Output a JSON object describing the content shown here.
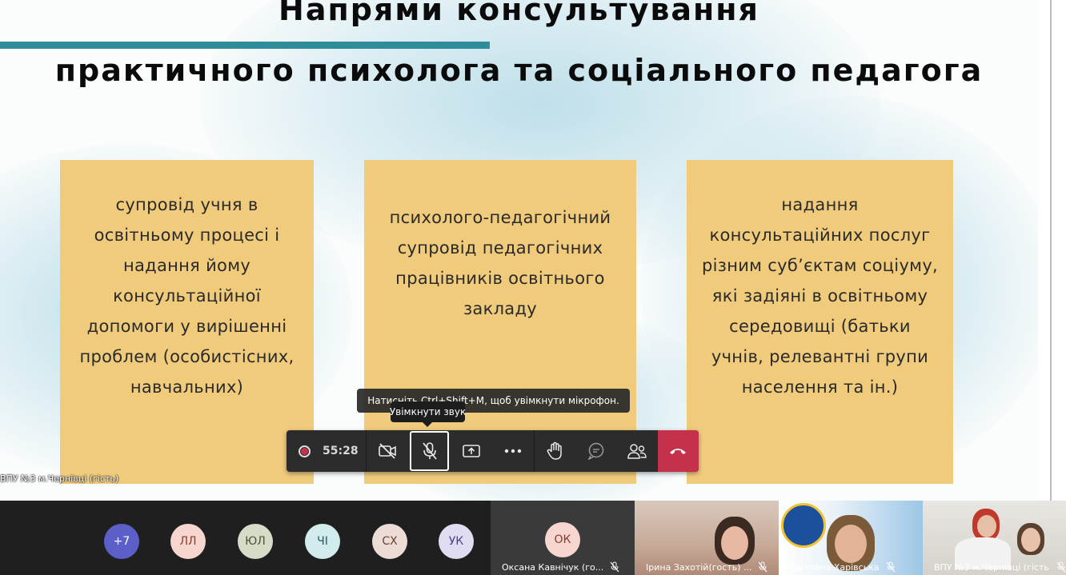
{
  "slide": {
    "title_line1": "Напрями консультування",
    "title_line2": "практичного психолога та соціального педагога",
    "cards": [
      "супровід учня в\nосвітньому процесі і\nнадання йому\nконсультаційної\nдопомоги у вирішенні\nпроблем (особистісних,\nнавчальних)",
      "психолого-педагогічний\nсупровід педагогічних\nпрацівників освітнього\nзакладу",
      "надання\nконсультаційних послуг\nрізним суб’єктам соціуму,\nякі задіяні в освітньому\nсередовищі (батьки\nучнів, релевантні групи\nнаселення та ін.)"
    ],
    "presenter_label": "ВПУ №3 м.Чернівці (гість)",
    "colors": {
      "card": "#f1cb7c",
      "accent_bar": "#2e8d98"
    }
  },
  "tooltips": {
    "hotkey": "Натисніть Ctrl+Shift+M, щоб увімкнути мікрофон.",
    "unmute": "Увімкнути звук"
  },
  "controls": {
    "timer": "55:28",
    "buttons": [
      {
        "name": "camera-off-button",
        "icon": "camera-off-icon"
      },
      {
        "name": "mic-unmute-button",
        "icon": "mic-off-icon"
      },
      {
        "name": "share-screen-button",
        "icon": "share-screen-icon"
      },
      {
        "name": "more-options-button",
        "icon": "more-icon"
      },
      {
        "name": "raise-hand-button",
        "icon": "hand-icon"
      },
      {
        "name": "chat-button",
        "icon": "chat-icon"
      },
      {
        "name": "participants-button",
        "icon": "people-icon"
      },
      {
        "name": "hang-up-button",
        "icon": "phone-hangup-icon"
      }
    ],
    "hangup_color": "#c4314b"
  },
  "participants": {
    "overflow": "+7",
    "avatars": [
      "ЛЛ",
      "ЮЛ",
      "ЧІ",
      "СХ",
      "УК"
    ],
    "active_tile": {
      "initials": "ОК",
      "name": "Оксана Кавнічук (го..."
    },
    "video_tiles": [
      {
        "name": "Ірина Захотій(гость) ..."
      },
      {
        "name": "Світлана Харівська"
      },
      {
        "name": "ВПУ №3 м.Чернівці (гість)"
      }
    ]
  }
}
